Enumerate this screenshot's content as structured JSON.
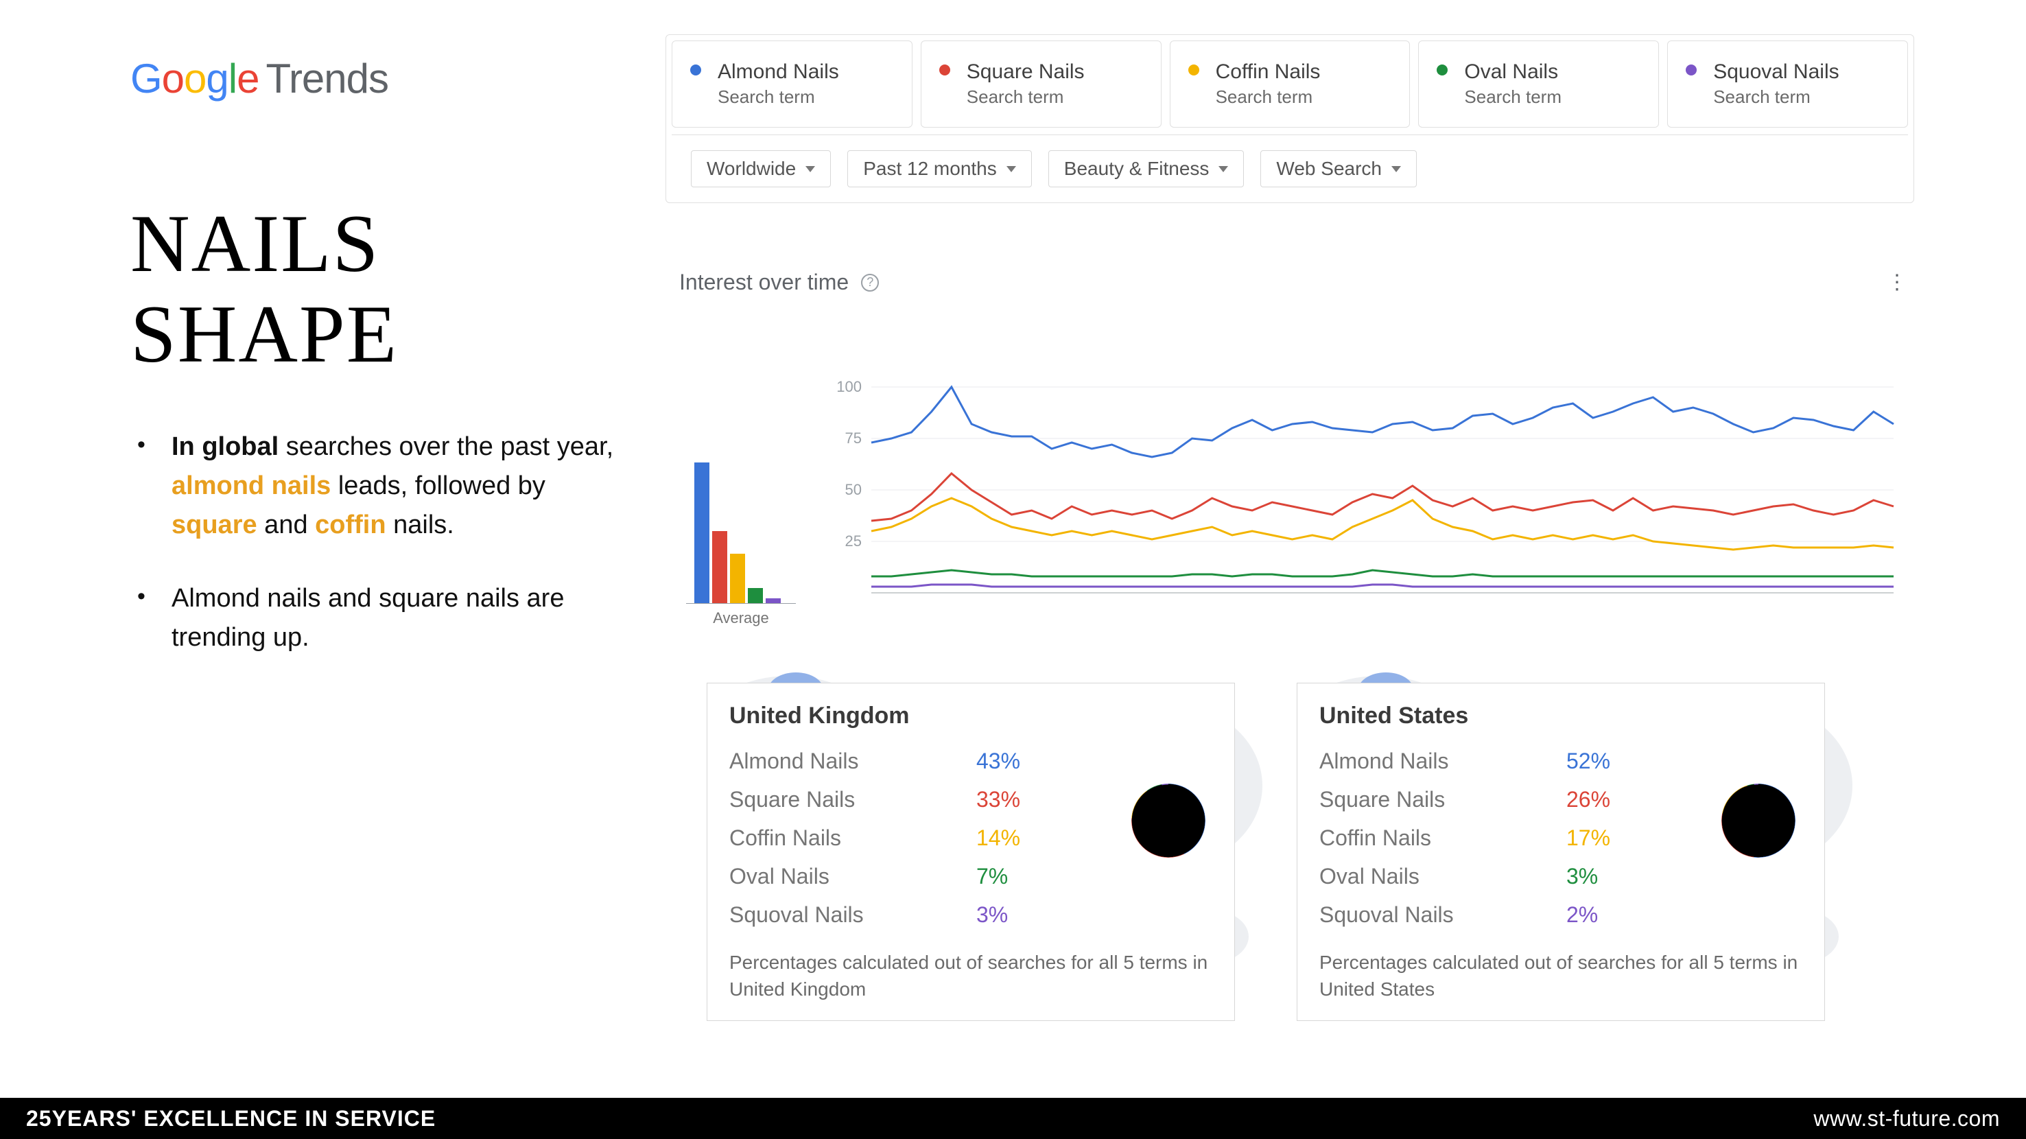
{
  "branding": {
    "logo_word": "Google",
    "trends_word": "Trends"
  },
  "heading_line1": "NAILS",
  "heading_line2": "SHAPE",
  "bullets": {
    "b1_prefix": "In global",
    "b1_text_1": " searches over the past year, ",
    "b1_hl_1": "almond nails",
    "b1_text_2": " leads, followed by ",
    "b1_hl_2": "square",
    "b1_text_3": " and ",
    "b1_hl_3": "coffin",
    "b1_text_4": " nails.",
    "b2": "Almond nails and square nails are trending up."
  },
  "colors": {
    "almond": "#3973d6",
    "square": "#db4437",
    "coffin": "#f3b400",
    "oval": "#1e8e3e",
    "squoval": "#7b55c7"
  },
  "terms": [
    {
      "name": "Almond Nails",
      "sub": "Search term",
      "color": "#3973d6"
    },
    {
      "name": "Square Nails",
      "sub": "Search term",
      "color": "#db4437"
    },
    {
      "name": "Coffin Nails",
      "sub": "Search term",
      "color": "#f3b400"
    },
    {
      "name": "Oval Nails",
      "sub": "Search term",
      "color": "#1e8e3e"
    },
    {
      "name": "Squoval Nails",
      "sub": "Search term",
      "color": "#7b55c7"
    }
  ],
  "filters": {
    "region": "Worldwide",
    "time": "Past 12 months",
    "category": "Beauty & Fitness",
    "search_type": "Web Search"
  },
  "section_title": "Interest over time",
  "avg_label": "Average",
  "chart_data": {
    "type": "line",
    "title": "Interest over time",
    "xlabel": "",
    "ylabel": "",
    "ylim": [
      0,
      100
    ],
    "yticks": [
      25,
      50,
      75,
      100
    ],
    "x": [
      0,
      1,
      2,
      3,
      4,
      5,
      6,
      7,
      8,
      9,
      10,
      11,
      12,
      13,
      14,
      15,
      16,
      17,
      18,
      19,
      20,
      21,
      22,
      23,
      24,
      25,
      26,
      27,
      28,
      29,
      30,
      31,
      32,
      33,
      34,
      35,
      36,
      37,
      38,
      39,
      40,
      41,
      42,
      43,
      44,
      45,
      46,
      47,
      48,
      49,
      50,
      51
    ],
    "series": [
      {
        "name": "Almond Nails",
        "color": "#3973d6",
        "values": [
          73,
          75,
          78,
          88,
          100,
          82,
          78,
          76,
          76,
          70,
          73,
          70,
          72,
          68,
          66,
          68,
          75,
          74,
          80,
          84,
          79,
          82,
          83,
          80,
          79,
          78,
          82,
          83,
          79,
          80,
          86,
          87,
          82,
          85,
          90,
          92,
          85,
          88,
          92,
          95,
          88,
          90,
          87,
          82,
          78,
          80,
          85,
          84,
          81,
          79,
          88,
          82
        ]
      },
      {
        "name": "Square Nails",
        "color": "#db4437",
        "values": [
          35,
          36,
          40,
          48,
          58,
          50,
          44,
          38,
          40,
          36,
          42,
          38,
          40,
          38,
          40,
          36,
          40,
          46,
          42,
          40,
          44,
          42,
          40,
          38,
          44,
          48,
          46,
          52,
          45,
          42,
          46,
          40,
          42,
          40,
          42,
          44,
          45,
          40,
          46,
          40,
          42,
          41,
          40,
          38,
          40,
          42,
          43,
          40,
          38,
          40,
          45,
          42
        ]
      },
      {
        "name": "Coffin Nails",
        "color": "#f3b400",
        "values": [
          30,
          32,
          36,
          42,
          46,
          42,
          36,
          32,
          30,
          28,
          30,
          28,
          30,
          28,
          26,
          28,
          30,
          32,
          28,
          30,
          28,
          26,
          28,
          26,
          32,
          36,
          40,
          45,
          36,
          32,
          30,
          26,
          28,
          26,
          28,
          26,
          28,
          26,
          28,
          25,
          24,
          23,
          22,
          21,
          22,
          23,
          22,
          22,
          22,
          22,
          23,
          22
        ]
      },
      {
        "name": "Oval Nails",
        "color": "#1e8e3e",
        "values": [
          8,
          8,
          9,
          10,
          11,
          10,
          9,
          9,
          8,
          8,
          8,
          8,
          8,
          8,
          8,
          8,
          9,
          9,
          8,
          9,
          9,
          8,
          8,
          8,
          9,
          11,
          10,
          9,
          8,
          8,
          9,
          8,
          8,
          8,
          8,
          8,
          8,
          8,
          8,
          8,
          8,
          8,
          8,
          8,
          8,
          8,
          8,
          8,
          8,
          8,
          8,
          8
        ]
      },
      {
        "name": "Squoval Nails",
        "color": "#7b55c7",
        "values": [
          3,
          3,
          3,
          4,
          4,
          4,
          3,
          3,
          3,
          3,
          3,
          3,
          3,
          3,
          3,
          3,
          3,
          3,
          3,
          3,
          3,
          3,
          3,
          3,
          3,
          4,
          4,
          3,
          3,
          3,
          3,
          3,
          3,
          3,
          3,
          3,
          3,
          3,
          3,
          3,
          3,
          3,
          3,
          3,
          3,
          3,
          3,
          3,
          3,
          3,
          3,
          3
        ]
      }
    ],
    "average_bars": [
      {
        "name": "Almond Nails",
        "value": 82,
        "color": "#3973d6"
      },
      {
        "name": "Square Nails",
        "value": 42,
        "color": "#db4437"
      },
      {
        "name": "Coffin Nails",
        "value": 29,
        "color": "#f3b400"
      },
      {
        "name": "Oval Nails",
        "value": 9,
        "color": "#1e8e3e"
      },
      {
        "name": "Squoval Nails",
        "value": 3,
        "color": "#7b55c7"
      }
    ]
  },
  "regions": [
    {
      "title": "United Kingdom",
      "note": "Percentages calculated out of searches for all 5 terms in United Kingdom",
      "items": [
        {
          "name": "Almond Nails",
          "pct": "43%",
          "value": 43,
          "color": "#3973d6"
        },
        {
          "name": "Square Nails",
          "pct": "33%",
          "value": 33,
          "color": "#db4437"
        },
        {
          "name": "Coffin Nails",
          "pct": "14%",
          "value": 14,
          "color": "#f3b400"
        },
        {
          "name": "Oval Nails",
          "pct": "7%",
          "value": 7,
          "color": "#1e8e3e"
        },
        {
          "name": "Squoval Nails",
          "pct": "3%",
          "value": 3,
          "color": "#7b55c7"
        }
      ]
    },
    {
      "title": "United States",
      "note": "Percentages calculated out of searches for all 5 terms in United States",
      "items": [
        {
          "name": "Almond Nails",
          "pct": "52%",
          "value": 52,
          "color": "#3973d6"
        },
        {
          "name": "Square Nails",
          "pct": "26%",
          "value": 26,
          "color": "#db4437"
        },
        {
          "name": "Coffin Nails",
          "pct": "17%",
          "value": 17,
          "color": "#f3b400"
        },
        {
          "name": "Oval Nails",
          "pct": "3%",
          "value": 3,
          "color": "#1e8e3e"
        },
        {
          "name": "Squoval Nails",
          "pct": "2%",
          "value": 2,
          "color": "#7b55c7"
        }
      ]
    }
  ],
  "footer": {
    "left": "25YEARS' EXCELLENCE IN SERVICE",
    "right": "www.st-future.com"
  }
}
